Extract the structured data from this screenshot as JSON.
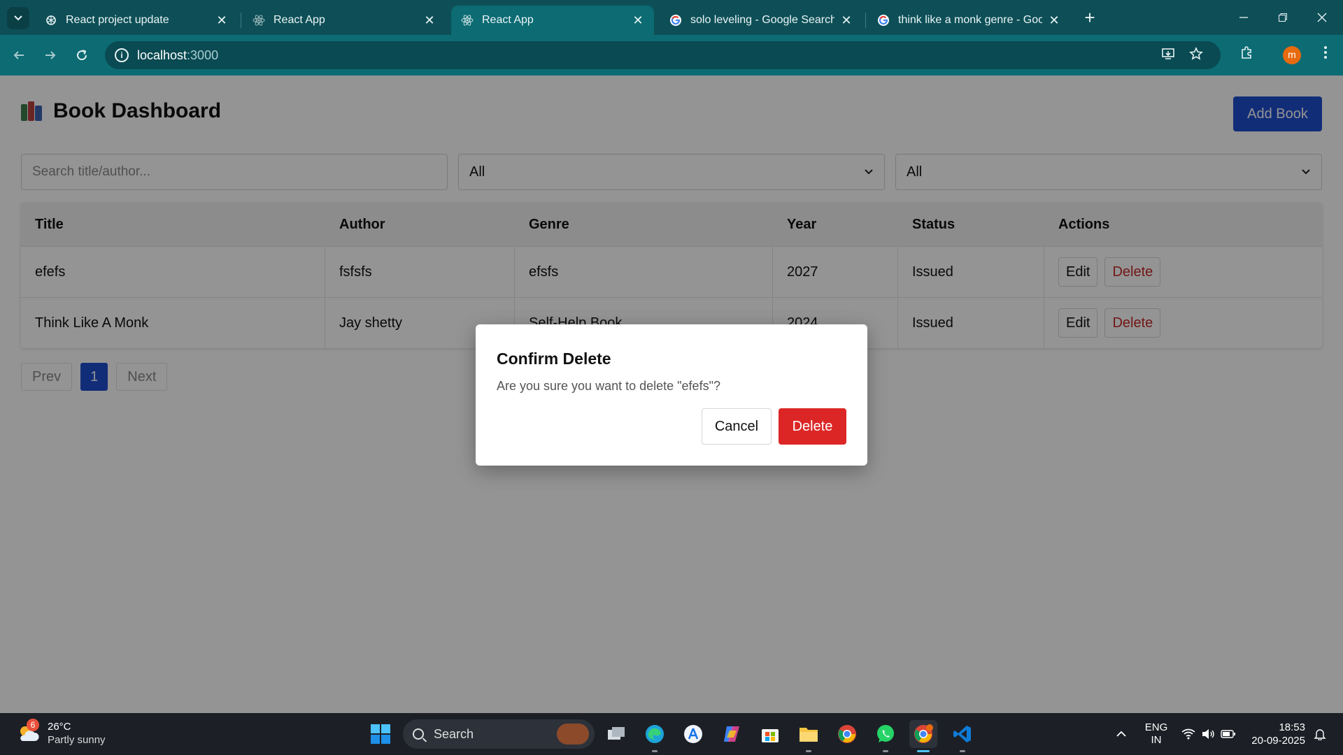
{
  "browser": {
    "tabs": [
      {
        "title": "React project update",
        "icon": "chatgpt-icon",
        "active": false
      },
      {
        "title": "React App",
        "icon": "react-icon",
        "active": false
      },
      {
        "title": "React App",
        "icon": "react-icon",
        "active": true
      },
      {
        "title": "solo leveling - Google Search",
        "icon": "google-icon",
        "active": false
      },
      {
        "title": "think like a monk genre - Google",
        "icon": "google-icon",
        "active": false
      }
    ],
    "url_host": "localhost",
    "url_port": ":3000",
    "profile_initial": "m"
  },
  "app": {
    "title": "Book Dashboard",
    "add_button": "Add Book",
    "search_placeholder": "Search title/author...",
    "genre_filter": "All",
    "status_filter": "All",
    "columns": [
      "Title",
      "Author",
      "Genre",
      "Year",
      "Status",
      "Actions"
    ],
    "rows": [
      {
        "title": "efefs",
        "author": "fsfsfs",
        "genre": "efsfs",
        "year": "2027",
        "status": "Issued"
      },
      {
        "title": "Think Like A Monk",
        "author": "Jay shetty",
        "genre": "Self-Help Book",
        "year": "2024",
        "status": "Issued"
      }
    ],
    "edit_label": "Edit",
    "delete_label": "Delete",
    "pagination": {
      "prev": "Prev",
      "current": "1",
      "next": "Next"
    }
  },
  "modal": {
    "title": "Confirm Delete",
    "message": "Are you sure you want to delete \"efefs\"?",
    "cancel": "Cancel",
    "confirm": "Delete"
  },
  "taskbar": {
    "weather_temp": "26°C",
    "weather_cond": "Partly sunny",
    "weather_badge": "6",
    "search_label": "Search",
    "lang_top": "ENG",
    "lang_bottom": "IN",
    "time": "18:53",
    "date": "20-09-2025"
  },
  "colors": {
    "chrome_dark": "#0e4f57",
    "chrome_active": "#0c6b73",
    "primary": "#1f4fcf",
    "danger": "#dc2626"
  }
}
